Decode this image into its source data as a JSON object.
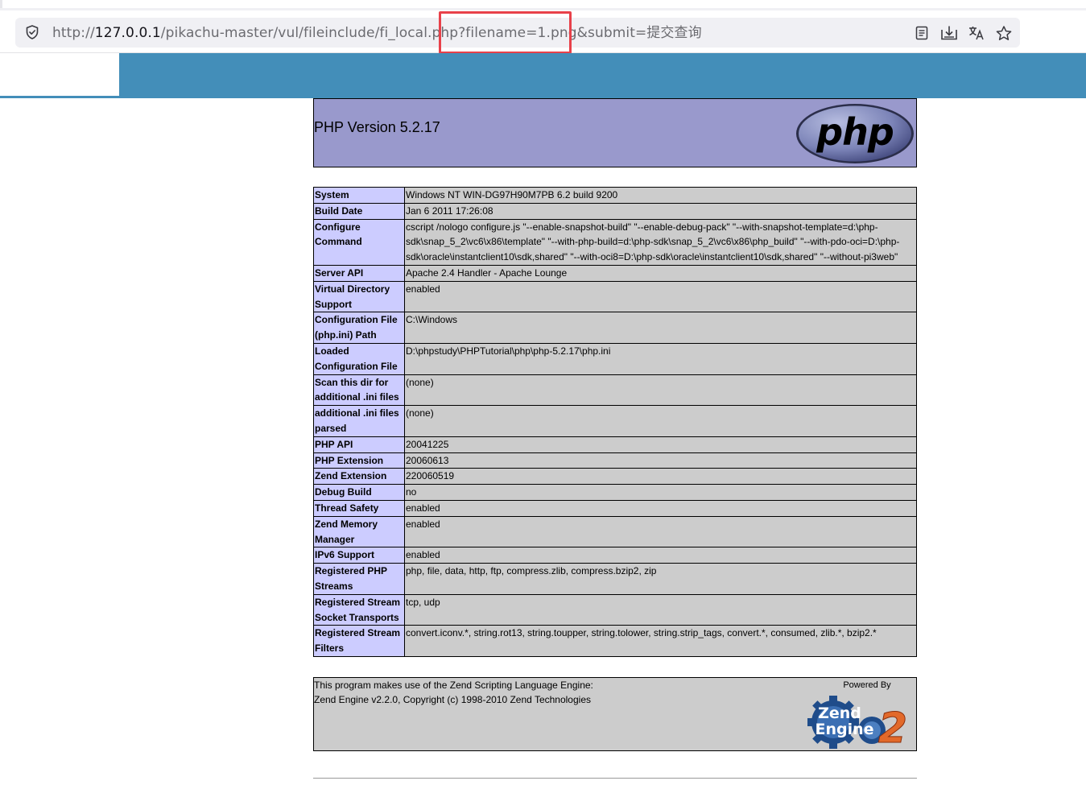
{
  "browser": {
    "url_prefix": "http://",
    "url_host": "127.0.0.1",
    "url_path": "/pikachu-master/vul/fileinclude/fi_local.php",
    "url_query": "?filename=1.png&submit=提交查询",
    "icons": [
      "shield-icon",
      "reader-view-icon",
      "download-icon",
      "translate-icon",
      "bookmark-star-icon"
    ]
  },
  "colors": {
    "header_bar": "#438eb9",
    "php_header": "#9999cc",
    "key_cell": "#ccccff",
    "value_cell": "#cccccc",
    "highlight": "#e8414a"
  },
  "phpinfo": {
    "version_title": "PHP Version 5.2.17",
    "php_logo_text": "php",
    "rows": [
      {
        "key": "System",
        "value": "Windows NT WIN-DG97H90M7PB 6.2 build 9200"
      },
      {
        "key": "Build Date",
        "value": "Jan 6 2011 17:26:08"
      },
      {
        "key": "Configure Command",
        "value": "cscript /nologo configure.js \"--enable-snapshot-build\" \"--enable-debug-pack\" \"--with-snapshot-template=d:\\php-sdk\\snap_5_2\\vc6\\x86\\template\" \"--with-php-build=d:\\php-sdk\\snap_5_2\\vc6\\x86\\php_build\" \"--with-pdo-oci=D:\\php-sdk\\oracle\\instantclient10\\sdk,shared\" \"--with-oci8=D:\\php-sdk\\oracle\\instantclient10\\sdk,shared\" \"--without-pi3web\""
      },
      {
        "key": "Server API",
        "value": "Apache 2.4 Handler - Apache Lounge"
      },
      {
        "key": "Virtual Directory Support",
        "value": "enabled"
      },
      {
        "key": "Configuration File (php.ini) Path",
        "value": "C:\\Windows"
      },
      {
        "key": "Loaded Configuration File",
        "value": "D:\\phpstudy\\PHPTutorial\\php\\php-5.2.17\\php.ini"
      },
      {
        "key": "Scan this dir for additional .ini files",
        "value": "(none)"
      },
      {
        "key": "additional .ini files parsed",
        "value": "(none)"
      },
      {
        "key": "PHP API",
        "value": "20041225"
      },
      {
        "key": "PHP Extension",
        "value": "20060613"
      },
      {
        "key": "Zend Extension",
        "value": "220060519"
      },
      {
        "key": "Debug Build",
        "value": "no"
      },
      {
        "key": "Thread Safety",
        "value": "enabled"
      },
      {
        "key": "Zend Memory Manager",
        "value": "enabled"
      },
      {
        "key": "IPv6 Support",
        "value": "enabled"
      },
      {
        "key": "Registered PHP Streams",
        "value": "php, file, data, http, ftp, compress.zlib, compress.bzip2, zip"
      },
      {
        "key": "Registered Stream Socket Transports",
        "value": "tcp, udp"
      },
      {
        "key": "Registered Stream Filters",
        "value": "convert.iconv.*, string.rot13, string.toupper, string.tolower, string.strip_tags, convert.*, consumed, zlib.*, bzip2.*"
      }
    ],
    "zend_line1": "This program makes use of the Zend Scripting Language Engine:",
    "zend_line2": "Zend Engine v2.2.0, Copyright (c) 1998-2010 Zend Technologies",
    "zend_powered": "Powered By",
    "zend_logo_word1": "Zend",
    "zend_logo_word2": "Engine",
    "zend_logo_num": "2"
  }
}
